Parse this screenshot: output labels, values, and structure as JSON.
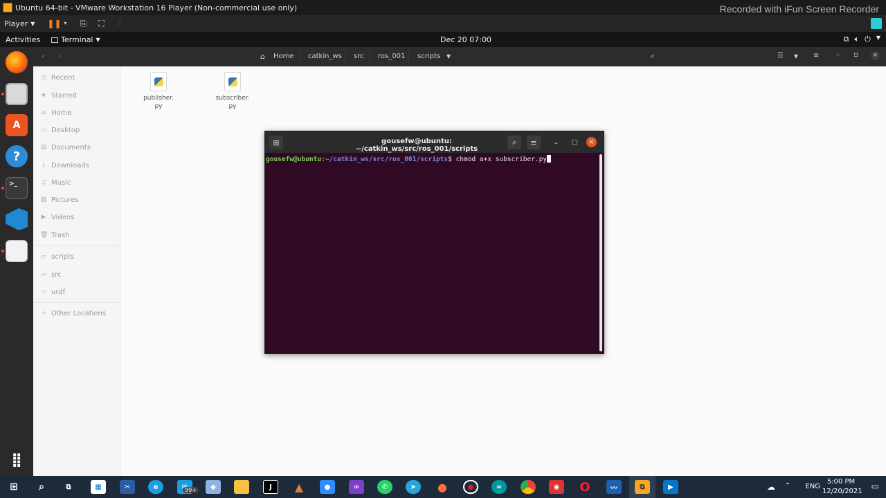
{
  "vmware": {
    "title": "Ubuntu 64-bit - VMware Workstation 16 Player (Non-commercial use only)",
    "watermark": "Recorded with iFun Screen Recorder",
    "player_menu": "Player"
  },
  "ubuntu_bar": {
    "activities": "Activities",
    "app_menu": "Terminal",
    "clock": "Dec 20  07:00"
  },
  "dock": {
    "items": [
      "firefox-icon",
      "files-icon",
      "software-icon",
      "help-icon",
      "terminal-icon",
      "vscode-icon",
      "text-editor-icon",
      "show-apps-icon"
    ]
  },
  "files": {
    "breadcrumb": [
      "Home",
      "catkin_ws",
      "src",
      "ros_001",
      "scripts"
    ],
    "sidebar": [
      {
        "label": "Recent",
        "icon": "clock-icon"
      },
      {
        "label": "Starred",
        "icon": "star-icon"
      },
      {
        "label": "Home",
        "icon": "home-icon"
      },
      {
        "label": "Desktop",
        "icon": "desktop-icon"
      },
      {
        "label": "Documents",
        "icon": "documents-icon"
      },
      {
        "label": "Downloads",
        "icon": "downloads-icon"
      },
      {
        "label": "Music",
        "icon": "music-icon"
      },
      {
        "label": "Pictures",
        "icon": "pictures-icon"
      },
      {
        "label": "Videos",
        "icon": "videos-icon"
      },
      {
        "label": "Trash",
        "icon": "trash-icon"
      },
      {
        "label": "scripts",
        "icon": "folder-icon"
      },
      {
        "label": "src",
        "icon": "folder-icon"
      },
      {
        "label": "urdf",
        "icon": "folder-icon"
      },
      {
        "label": "Other Locations",
        "icon": "plus-icon"
      }
    ],
    "items": [
      {
        "name_line1": "publisher.",
        "name_line2": "py"
      },
      {
        "name_line1": "subscriber.",
        "name_line2": "py"
      }
    ]
  },
  "terminal": {
    "title": "gousefw@ubuntu: ~/catkin_ws/src/ros_001/scripts",
    "prompt_user": "gousefw@ubuntu",
    "prompt_sep": ":",
    "prompt_path": "~/catkin_ws/src/ros_001/scripts",
    "prompt_symbol": "$ ",
    "command": "chmod a+x subscriber.py"
  },
  "taskbar": {
    "mail_badge": "99+",
    "language": "ENG",
    "time": "5:00 PM",
    "date": "12/20/2021"
  }
}
